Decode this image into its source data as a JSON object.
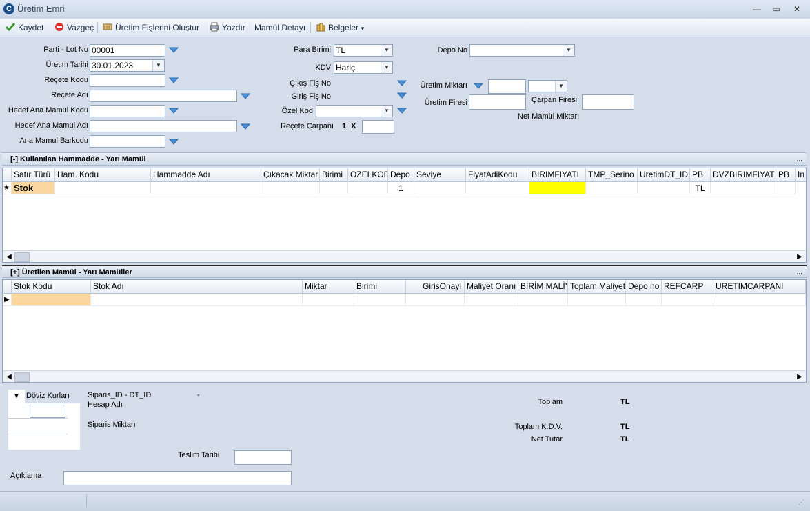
{
  "window": {
    "title": "Üretim Emri",
    "icon_letter": "C",
    "controls": [
      "—",
      "▭",
      "✕"
    ]
  },
  "toolbar": {
    "save_label": "Kaydet",
    "cancel_label": "Vazgeç",
    "create_slips_label": "Üretim Fişlerini Oluştur",
    "print_label": "Yazdır",
    "product_detail_label": "Mamül Detayı",
    "documents_label": "Belgeler"
  },
  "form": {
    "lot_no_label": "Parti - Lot No",
    "lot_no_value": "00001",
    "production_date_label": "Üretim Tarihi",
    "production_date_value": "30.01.2023",
    "recipe_code_label": "Reçete Kodu",
    "recipe_name_label": "Reçete Adı",
    "target_code_label": "Hedef Ana Mamul Kodu",
    "target_name_label": "Hedef Ana Mamul Adı",
    "barcode_label": "Ana Mamul Barkodu",
    "currency_label": "Para Birimi",
    "currency_value": "TL",
    "kdv_label": "KDV",
    "kdv_value": "Hariç",
    "exit_slip_label": "Çıkış Fiş No",
    "entry_slip_label": "Giriş Fiş No",
    "special_code_label": "Özel Kod",
    "recipe_multiplier_label": "Reçete Çarpanı",
    "recipe_multiplier_value": "1",
    "multiplier_x": "X",
    "depot_label": "Depo No",
    "production_qty_label": "Üretim Miktarı",
    "production_waste_label": "Üretim Firesi",
    "multiplier_waste_label": "Çarpan Firesi",
    "net_product_qty_label": "Net Mamül Miktarı"
  },
  "raw_materials": {
    "title": "[-] Kullanılan Hammadde - Yarı Mamül",
    "more": "...",
    "columns": [
      "Satır Türü",
      "Ham. Kodu",
      "Hammadde Adı",
      "Çıkacak Miktar",
      "Birimi",
      "OZELKOD",
      "Depo",
      "Seviye",
      "FiyatAdiKodu",
      "BIRIMFIYATI",
      "TMP_Serino",
      "UretimDT_ID",
      "PB",
      "DVZBIRIMFIYAT",
      "PB",
      "In"
    ],
    "new_row_marker": "★",
    "row": {
      "type": "Stok",
      "depot": "1",
      "pb": "TL"
    }
  },
  "products": {
    "title": "[+] Üretilen Mamül - Yarı Mamüller",
    "more": "...",
    "columns": [
      "Stok Kodu",
      "Stok Adı",
      "Miktar",
      "Birimi",
      "GirisOnayi",
      "Maliyet Oranı",
      "BİRİM MALİY",
      "Toplam Maliyet",
      "Depo no",
      "REFCARP",
      "URETIMCARPANI"
    ],
    "row_marker": "▶"
  },
  "footer": {
    "exchange_label": "Döviz Kurları",
    "order_id_label": "Siparis_ID - DT_ID",
    "order_id_value": "-",
    "account_name_label": "Hesap Adı",
    "order_qty_label": "Siparis Miktarı",
    "delivery_date_label": "Teslim Tarihi",
    "description_label": "Açıklama",
    "total_label": "Toplam",
    "total_currency": "TL",
    "total_kdv_label": "Toplam K.D.V.",
    "total_kdv_currency": "TL",
    "net_total_label": "Net Tutar",
    "net_total_currency": "TL"
  },
  "colors": {
    "orange_cell": "#fbd7a0",
    "yellow_cell": "#ffff00"
  }
}
